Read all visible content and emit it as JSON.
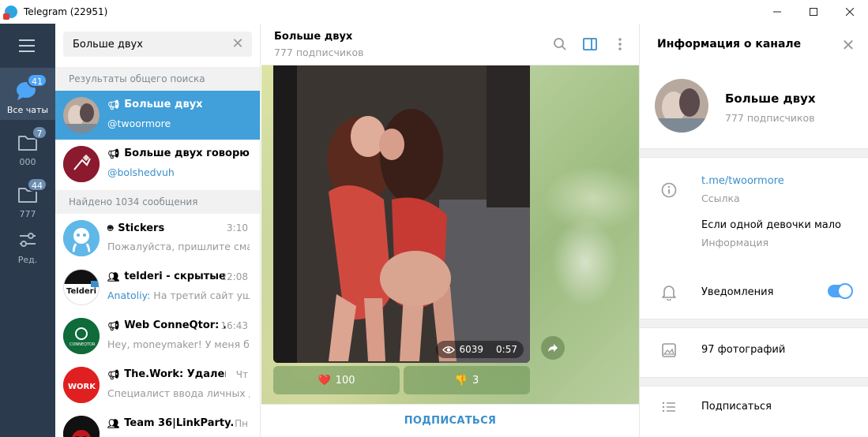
{
  "window": {
    "title": "Telegram (22951)"
  },
  "rail": {
    "items": [
      {
        "label": "Все чаты",
        "badge": "41"
      },
      {
        "label": "000",
        "badge": "7"
      },
      {
        "label": "777",
        "badge": "44"
      },
      {
        "label": "Ред."
      }
    ]
  },
  "search": {
    "value": "Больше двух"
  },
  "sections": {
    "global": "Результаты общего поиска",
    "messages": "Найдено 1034 сообщения"
  },
  "global_results": [
    {
      "title": "Больше двух",
      "subtitle": "@twoormore"
    },
    {
      "title": "Больше двух говорю в...",
      "subtitle": "@bolshedvuh"
    }
  ],
  "messages": [
    {
      "title": "Stickers",
      "time": "3:10",
      "author": "",
      "preview": "Пожалуйста, пришлите сма..."
    },
    {
      "title": "telderi - скрытые ...",
      "time": "22:08",
      "author": "Anatoliy:",
      "preview": " На третий сайт уш..."
    },
    {
      "title": "Web ConneQtor: ...",
      "time": "16:43",
      "author": "",
      "preview": "Hey, moneymaker! У меня б..."
    },
    {
      "title": "The.Work: Удаленн...",
      "time": "Чт",
      "author": "",
      "preview": "Специалист ввода личных д..."
    },
    {
      "title": "Team 36|LinkParty.ru",
      "time": "Пн",
      "author": "",
      "preview": ""
    }
  ],
  "chat": {
    "title": "Больше двух",
    "subtitle": "777 подписчиков",
    "post": {
      "views": "6039",
      "time": "0:57"
    },
    "reactions": [
      {
        "emoji": "❤️",
        "count": "100"
      },
      {
        "emoji": "👎",
        "count": "3"
      }
    ],
    "subscribe_label": "ПОДПИСАТЬСЯ"
  },
  "info": {
    "header": "Информация о канале",
    "name": "Больше двух",
    "count": "777 подписчиков",
    "link": "t.me/twoormore",
    "link_label": "Ссылка",
    "about": "Если одной девочки мало",
    "about_label": "Информация",
    "notifications": "Уведомления",
    "notifications_on": true,
    "photos": "97 фотографий",
    "subscribe": "Подписаться"
  },
  "colors": {
    "accent": "#419fd9",
    "rail": "#2b3a4d",
    "link": "#3a8fcc"
  }
}
